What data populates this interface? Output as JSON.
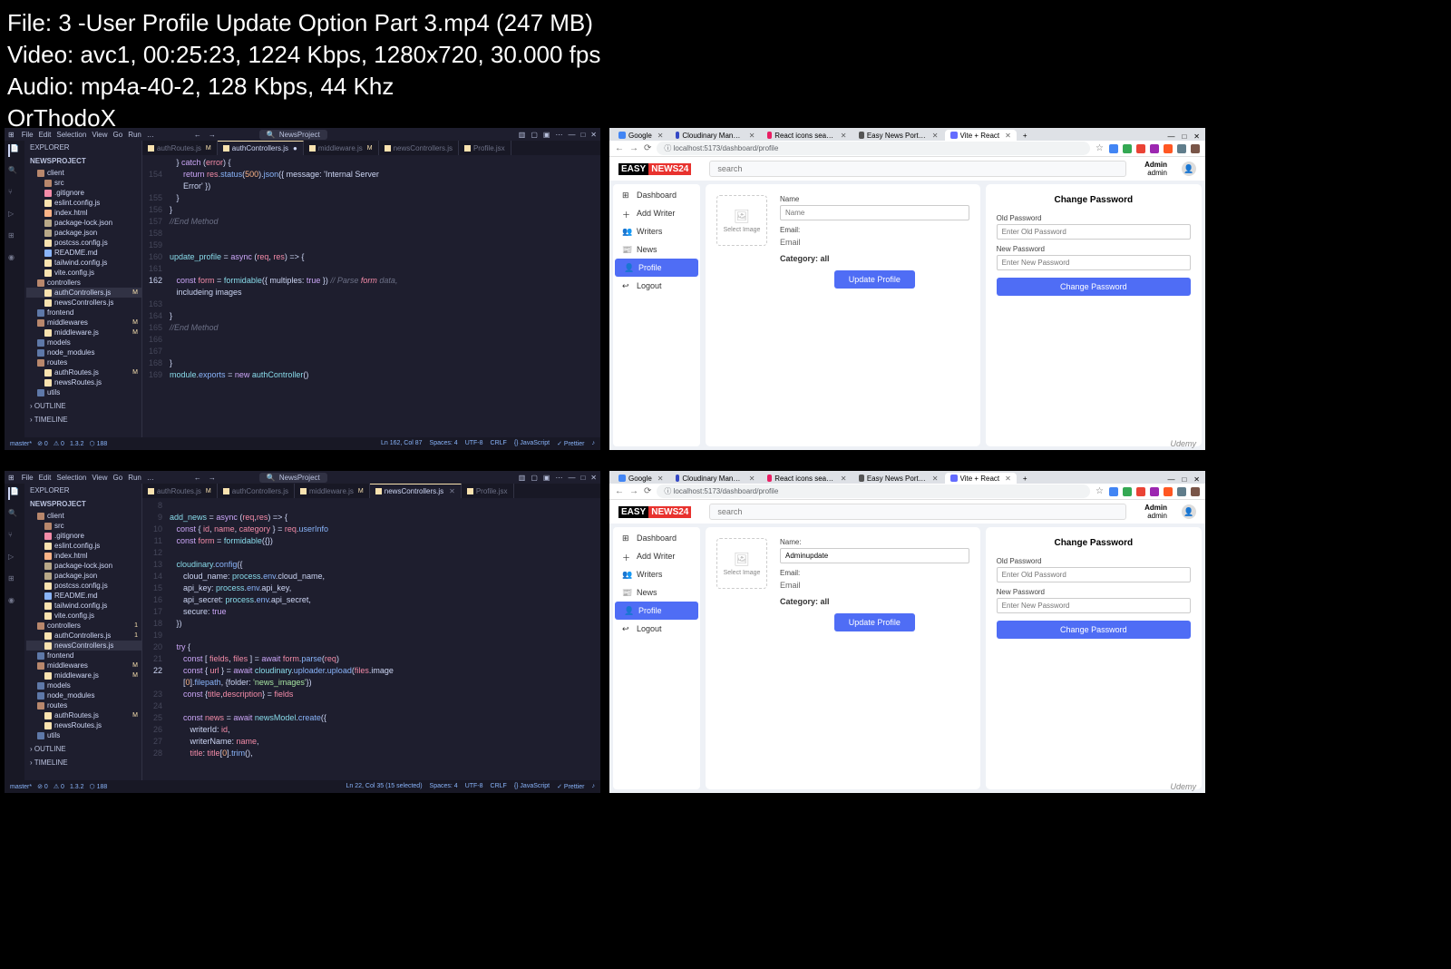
{
  "overlay": {
    "line1": "File: 3 -User Profile Update Option Part 3.mp4 (247 MB)",
    "line2": "Video: avc1, 00:25:23, 1224 Kbps, 1280x720, 30.000 fps",
    "line3": "Audio: mp4a-40-2, 128 Kbps, 44 Khz",
    "line4": "OrThodoX"
  },
  "watermark": "Udemy",
  "vscode_top": {
    "menu": [
      "File",
      "Edit",
      "Selection",
      "View",
      "Go",
      "Run",
      "…"
    ],
    "search_label": "NewsProject",
    "explorer_label": "EXPLORER",
    "project": "NEWSPROJECT",
    "tree": [
      {
        "t": "client",
        "k": "folder-o",
        "d": 1
      },
      {
        "t": "src",
        "k": "folder-o",
        "d": 2
      },
      {
        "t": ".gitignore",
        "k": "git",
        "d": 2
      },
      {
        "t": "eslint.config.js",
        "k": "js",
        "d": 2
      },
      {
        "t": "index.html",
        "k": "html",
        "d": 2
      },
      {
        "t": "package-lock.json",
        "k": "json",
        "d": 2
      },
      {
        "t": "package.json",
        "k": "json",
        "d": 2
      },
      {
        "t": "postcss.config.js",
        "k": "js",
        "d": 2
      },
      {
        "t": "README.md",
        "k": "md",
        "d": 2
      },
      {
        "t": "tailwind.config.js",
        "k": "js",
        "d": 2
      },
      {
        "t": "vite.config.js",
        "k": "js",
        "d": 2
      },
      {
        "t": "controllers",
        "k": "folder-o",
        "d": 1
      },
      {
        "t": "authControllers.js",
        "k": "js",
        "d": 2,
        "sel": true,
        "mod": true
      },
      {
        "t": "newsControllers.js",
        "k": "js",
        "d": 2
      },
      {
        "t": "frontend",
        "k": "folder",
        "d": 1
      },
      {
        "t": "middlewares",
        "k": "folder-o",
        "d": 1,
        "mod": true
      },
      {
        "t": "middleware.js",
        "k": "js",
        "d": 2,
        "mod": true
      },
      {
        "t": "models",
        "k": "folder",
        "d": 1
      },
      {
        "t": "node_modules",
        "k": "folder",
        "d": 1
      },
      {
        "t": "routes",
        "k": "folder-o",
        "d": 1
      },
      {
        "t": "authRoutes.js",
        "k": "js",
        "d": 2,
        "mod": true
      },
      {
        "t": "newsRoutes.js",
        "k": "js",
        "d": 2
      },
      {
        "t": "utils",
        "k": "folder",
        "d": 1
      }
    ],
    "outline": "OUTLINE",
    "timeline": "TIMELINE",
    "tabs": [
      {
        "t": "authRoutes.js",
        "mod": true
      },
      {
        "t": "authControllers.js",
        "active": true,
        "unsav": true
      },
      {
        "t": "middleware.js",
        "mod": true
      },
      {
        "t": "newsControllers.js"
      },
      {
        "t": "Profile.jsx"
      }
    ],
    "code": [
      {
        "n": "",
        "t": "   } catch (error) {"
      },
      {
        "n": "154",
        "t": "      return res.status(500).json({ message: 'Internal Server"
      },
      {
        "n": "",
        "t": "      Error' })"
      },
      {
        "n": "155",
        "t": "   }"
      },
      {
        "n": "156",
        "t": "}"
      },
      {
        "n": "157",
        "t": "//End Method"
      },
      {
        "n": "158",
        "t": ""
      },
      {
        "n": "159",
        "t": ""
      },
      {
        "n": "160",
        "t": "update_profile = async (req, res) => {"
      },
      {
        "n": "161",
        "t": ""
      },
      {
        "n": "162",
        "t": "   const form = formidable({ multiples: true }) // Parse form data,",
        "cur": true
      },
      {
        "n": "",
        "t": "   includeing images"
      },
      {
        "n": "163",
        "t": ""
      },
      {
        "n": "164",
        "t": "}"
      },
      {
        "n": "165",
        "t": "//End Method"
      },
      {
        "n": "166",
        "t": ""
      },
      {
        "n": "167",
        "t": ""
      },
      {
        "n": "168",
        "t": "}"
      },
      {
        "n": "169",
        "t": "module.exports = new authController()"
      }
    ],
    "status_left": [
      "master*",
      "⊘ 0",
      "⚠ 0",
      "1.3.2",
      "⬡ 188"
    ],
    "status_right": [
      "Ln 162, Col 87",
      "Spaces: 4",
      "UTF-8",
      "CRLF",
      "{} JavaScript",
      "✓ Prettier",
      "♪"
    ]
  },
  "vscode_bottom": {
    "tree": [
      {
        "t": "client",
        "k": "folder-o",
        "d": 1
      },
      {
        "t": "src",
        "k": "folder-o",
        "d": 2
      },
      {
        "t": ".gitignore",
        "k": "git",
        "d": 2
      },
      {
        "t": "eslint.config.js",
        "k": "js",
        "d": 2
      },
      {
        "t": "index.html",
        "k": "html",
        "d": 2
      },
      {
        "t": "package-lock.json",
        "k": "json",
        "d": 2
      },
      {
        "t": "package.json",
        "k": "json",
        "d": 2
      },
      {
        "t": "postcss.config.js",
        "k": "js",
        "d": 2
      },
      {
        "t": "README.md",
        "k": "md",
        "d": 2
      },
      {
        "t": "tailwind.config.js",
        "k": "js",
        "d": 2
      },
      {
        "t": "vite.config.js",
        "k": "js",
        "d": 2
      },
      {
        "t": "controllers",
        "k": "folder-o",
        "d": 1,
        "num": true
      },
      {
        "t": "authControllers.js",
        "k": "js",
        "d": 2,
        "num": true
      },
      {
        "t": "newsControllers.js",
        "k": "js",
        "d": 2,
        "sel": true
      },
      {
        "t": "frontend",
        "k": "folder",
        "d": 1
      },
      {
        "t": "middlewares",
        "k": "folder-o",
        "d": 1,
        "mod": true
      },
      {
        "t": "middleware.js",
        "k": "js",
        "d": 2,
        "mod": true
      },
      {
        "t": "models",
        "k": "folder",
        "d": 1
      },
      {
        "t": "node_modules",
        "k": "folder",
        "d": 1
      },
      {
        "t": "routes",
        "k": "folder-o",
        "d": 1
      },
      {
        "t": "authRoutes.js",
        "k": "js",
        "d": 2,
        "mod": true
      },
      {
        "t": "newsRoutes.js",
        "k": "js",
        "d": 2
      },
      {
        "t": "utils",
        "k": "folder",
        "d": 1
      }
    ],
    "tabs": [
      {
        "t": "authRoutes.js",
        "mod": true
      },
      {
        "t": "authControllers.js",
        "num": true
      },
      {
        "t": "middleware.js",
        "mod": true
      },
      {
        "t": "newsControllers.js",
        "active": true,
        "close": true
      },
      {
        "t": "Profile.jsx"
      }
    ],
    "code": [
      {
        "n": "8",
        "t": ""
      },
      {
        "n": "9",
        "t": "add_news = async (req,res) => {"
      },
      {
        "n": "10",
        "t": "   const { id, name, category } = req.userInfo"
      },
      {
        "n": "11",
        "t": "   const form = formidable({})"
      },
      {
        "n": "12",
        "t": ""
      },
      {
        "n": "13",
        "t": "   cloudinary.config({"
      },
      {
        "n": "14",
        "t": "      cloud_name: process.env.cloud_name,"
      },
      {
        "n": "15",
        "t": "      api_key: process.env.api_key,"
      },
      {
        "n": "16",
        "t": "      api_secret: process.env.api_secret,"
      },
      {
        "n": "17",
        "t": "      secure: true"
      },
      {
        "n": "18",
        "t": "   })"
      },
      {
        "n": "19",
        "t": ""
      },
      {
        "n": "20",
        "t": "   try {"
      },
      {
        "n": "21",
        "t": "      const [ fields, files ] = await form.parse(req)"
      },
      {
        "n": "22",
        "t": "      const { url } = await cloudinary.uploader.upload(files.image",
        "cur": true
      },
      {
        "n": "",
        "t": "      [0].filepath, {folder: 'news_images'})"
      },
      {
        "n": "23",
        "t": "      const {title,description} = fields"
      },
      {
        "n": "24",
        "t": ""
      },
      {
        "n": "25",
        "t": "      const news = await newsModel.create({"
      },
      {
        "n": "26",
        "t": "         writerId: id,"
      },
      {
        "n": "27",
        "t": "         writerName: name,"
      },
      {
        "n": "28",
        "t": "         title: title[0].trim(),"
      }
    ],
    "status_right": [
      "Ln 22, Col 35 (15 selected)",
      "Spaces: 4",
      "UTF-8",
      "CRLF",
      "{} JavaScript",
      "✓ Prettier",
      "♪"
    ]
  },
  "browser": {
    "tabs": [
      {
        "t": "Google",
        "ico": "#4285f4"
      },
      {
        "t": "Cloudinary Management Con…",
        "ico": "#3448c5"
      },
      {
        "t": "React icons search results",
        "ico": "#e91e63"
      },
      {
        "t": "Easy News Portal Ninja",
        "ico": "#555"
      },
      {
        "t": "Vite + React",
        "ico": "#646cff",
        "active": true
      }
    ],
    "url": "localhost:5173/dashboard/profile",
    "ext_colors": [
      "#4285f4",
      "#34a853",
      "#ea4335",
      "#9c27b0",
      "#ff5722",
      "#607d8b",
      "#795548"
    ],
    "logo": {
      "easy": "EASY",
      "news": "NEWS24"
    },
    "search_placeholder": "search",
    "user": {
      "name": "Admin",
      "role": "admin"
    },
    "sidebar": [
      {
        "t": "Dashboard",
        "ico": "⊞"
      },
      {
        "t": "Add Writer",
        "ico": "＋"
      },
      {
        "t": "Writers",
        "ico": "👥"
      },
      {
        "t": "News",
        "ico": "📰"
      },
      {
        "t": "Profile",
        "ico": "👤",
        "active": true
      },
      {
        "t": "Logout",
        "ico": "↩"
      }
    ],
    "profile_top": {
      "img_label": "Select Image",
      "name_label": "Name",
      "name_value": "",
      "name_placeholder": "Name",
      "email_label": "Email:",
      "email_value": "Email",
      "category_label": "Category: all",
      "update_btn": "Update Profile"
    },
    "profile_bottom": {
      "name_value": "Adminupdate"
    },
    "password": {
      "title": "Change Password",
      "old_label": "Old Password",
      "old_placeholder": "Enter Old Password",
      "new_label": "New Password",
      "new_placeholder": "Enter New Password",
      "btn": "Change Password"
    }
  }
}
